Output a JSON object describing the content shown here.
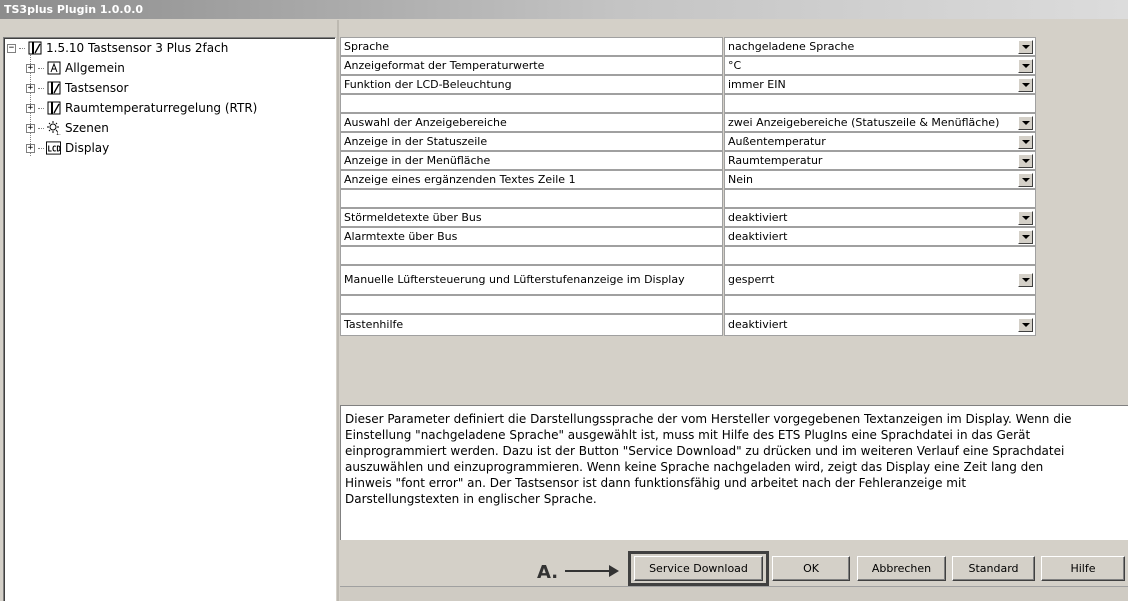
{
  "window": {
    "title": "TS3plus Plugin 1.0.0.0"
  },
  "tree": {
    "root": {
      "label": "1.5.10  Tastsensor 3 Plus 2fach",
      "icon": "device-icon"
    },
    "children": [
      {
        "label": "Allgemein",
        "icon": "general-icon"
      },
      {
        "label": "Tastsensor",
        "icon": "device-icon"
      },
      {
        "label": "Raumtemperaturregelung (RTR)",
        "icon": "device-icon"
      },
      {
        "label": "Szenen",
        "icon": "scene-icon"
      },
      {
        "label": "Display",
        "icon": "lcd-icon"
      }
    ]
  },
  "params": {
    "rows": [
      {
        "label": "Sprache",
        "value": "nachgeladene Sprache"
      },
      {
        "label": "Anzeigeformat  der Temperaturwerte",
        "value": "°C"
      },
      {
        "label": "Funktion der LCD-Beleuchtung",
        "value": "immer EIN"
      },
      {
        "label": "",
        "value": ""
      },
      {
        "label": "Auswahl der Anzeigebereiche",
        "value": "zwei Anzeigebereiche (Statuszeile & Menüfläche)"
      },
      {
        "label": "Anzeige in der Statuszeile",
        "value": "Außentemperatur"
      },
      {
        "label": "Anzeige in der Menüfläche",
        "value": "Raumtemperatur"
      },
      {
        "label": "Anzeige eines ergänzenden Textes Zeile 1",
        "value": "Nein"
      },
      {
        "label": "",
        "value": ""
      },
      {
        "label": "Störmeldetexte über Bus",
        "value": "deaktiviert"
      },
      {
        "label": "Alarmtexte über Bus",
        "value": "deaktiviert"
      },
      {
        "label": "",
        "value": ""
      },
      {
        "label": "Manuelle  Lüftersteuerung  und  Lüfterstufenanzeige  im  Display",
        "value": "gesperrt"
      },
      {
        "label": "",
        "value": ""
      },
      {
        "label": "Tastenhilfe",
        "value": "deaktiviert"
      }
    ]
  },
  "description": "Dieser Parameter definiert die Darstellungssprache der vom Hersteller vorgegebenen Textanzeigen im Display. Wenn die\nEinstellung \"nachgeladene Sprache\" ausgewählt ist, muss mit Hilfe des ETS PlugIns eine Sprachdatei in das Gerät\neinprogrammiert werden. Dazu ist der Button \"Service Download\" zu drücken und im weiteren Verlauf eine Sprachdatei\nauszuwählen und einzuprogrammieren. Wenn keine Sprache nachgeladen wird, zeigt das Display eine Zeit lang den\nHinweis \"font error\" an. Der Tastsensor ist dann funktionsfähig und arbeitet nach der Fehleranzeige mit\nDarstellungstexten in englischer Sprache.",
  "buttons": {
    "service_download": "Service Download",
    "ok": "OK",
    "cancel": "Abbrechen",
    "standard": "Standard",
    "help": "Hilfe"
  },
  "callout": {
    "label": "A."
  }
}
